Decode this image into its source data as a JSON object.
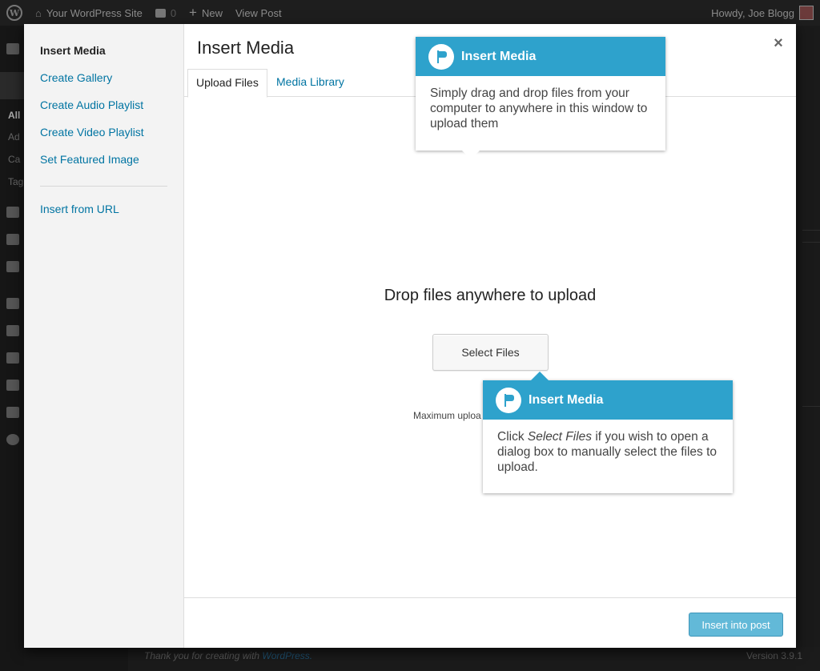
{
  "adminbar": {
    "logo_glyph": "W",
    "site_name": "Your WordPress Site",
    "comments_count": "0",
    "new_label": "New",
    "view_post_label": "View Post",
    "howdy": "Howdy, Joe Blogg"
  },
  "admin_menu": {
    "labels": [
      "All",
      "Ad",
      "Ca",
      "Tag"
    ]
  },
  "footer": {
    "thanks_prefix": "Thank you for creating with",
    "thanks_link": "WordPress.",
    "version": "Version 3.9.1"
  },
  "modal": {
    "menu": {
      "items": [
        "Insert Media",
        "Create Gallery",
        "Create Audio Playlist",
        "Create Video Playlist",
        "Set Featured Image"
      ],
      "url_item": "Insert from URL"
    },
    "title": "Insert Media",
    "close_glyph": "×",
    "tabs": [
      "Upload Files",
      "Media Library"
    ],
    "uploader": {
      "instructions": "Drop files anywhere to upload",
      "select_button": "Select Files",
      "max_size": "Maximum uploa"
    },
    "toolbar": {
      "insert_button": "Insert into post"
    }
  },
  "pointers": [
    {
      "title": "Insert Media",
      "body": "Simply drag and drop files from your computer to anywhere in this window to upload them"
    },
    {
      "title": "Insert Media",
      "body_prefix": "Click",
      "body_em": "Select Files",
      "body_suffix": "if you wish to open a dialog box to manually select the files to upload."
    }
  ],
  "colors": {
    "accent": "#2ea2cc",
    "link": "#0074a2"
  }
}
